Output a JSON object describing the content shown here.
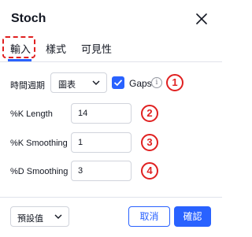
{
  "dialog": {
    "title": "Stoch"
  },
  "tabs": [
    {
      "label": "輸入"
    },
    {
      "label": "樣式"
    },
    {
      "label": "可見性"
    }
  ],
  "inputs": {
    "timeframe": {
      "label": "時間週期",
      "value": "圖表"
    },
    "gaps": {
      "label": "Gaps",
      "checked": true
    },
    "k_length": {
      "label": "%K Length",
      "value": "14"
    },
    "k_smoothing": {
      "label": "%K Smoothing",
      "value": "1"
    },
    "d_smoothing": {
      "label": "%D Smoothing",
      "value": "3"
    }
  },
  "annotations": [
    "1",
    "2",
    "3",
    "4"
  ],
  "footer": {
    "defaults": "預設值",
    "cancel": "取消",
    "ok": "確認"
  },
  "colors": {
    "accent": "#2962ff",
    "annotation": "#e02020"
  }
}
